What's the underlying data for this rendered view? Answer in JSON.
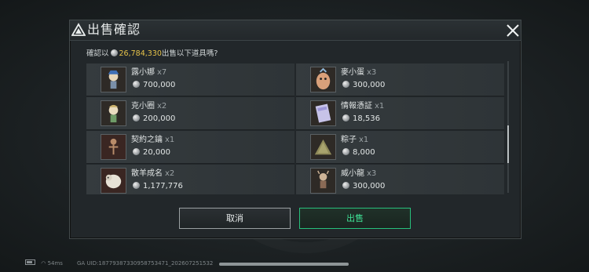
{
  "dialog": {
    "title": "出售確認",
    "confirm_prefix": "確認以",
    "confirm_amount": "26,784,330",
    "confirm_suffix": "出售以下道具嗎?",
    "cancel_label": "取消",
    "sell_label": "出售"
  },
  "items": [
    {
      "name": "露小娜",
      "qty": "x7",
      "price": "700,000",
      "icon": "figure-blue-hat",
      "col": 0,
      "row": 0
    },
    {
      "name": "麥小蛋",
      "qty": "x3",
      "price": "300,000",
      "icon": "egg-creature",
      "col": 1,
      "row": 0
    },
    {
      "name": "克小圈",
      "qty": "x2",
      "price": "200,000",
      "icon": "figure-green",
      "col": 0,
      "row": 1
    },
    {
      "name": "情報憑証",
      "qty": "x1",
      "price": "18,536",
      "icon": "intel-card",
      "col": 1,
      "row": 1
    },
    {
      "name": "契約之鑰",
      "qty": "x1",
      "price": "20,000",
      "icon": "figure-key",
      "col": 0,
      "row": 2
    },
    {
      "name": "粽子",
      "qty": "x1",
      "price": "8,000",
      "icon": "zongzi",
      "col": 1,
      "row": 2
    },
    {
      "name": "散羊成名",
      "qty": "x2",
      "price": "1,177,776",
      "icon": "sheep-figure",
      "col": 0,
      "row": 3
    },
    {
      "name": "威小龍",
      "qty": "x3",
      "price": "300,000",
      "icon": "dragon-figure",
      "col": 1,
      "row": 3
    }
  ],
  "status_bar": {
    "ping": "54ms",
    "uid": "GA UID:18779387330958753471_20260725153​2",
    "progress": 1.0
  },
  "colors": {
    "accent_gold": "#e6c34a",
    "sell_green": "#3fe396"
  }
}
